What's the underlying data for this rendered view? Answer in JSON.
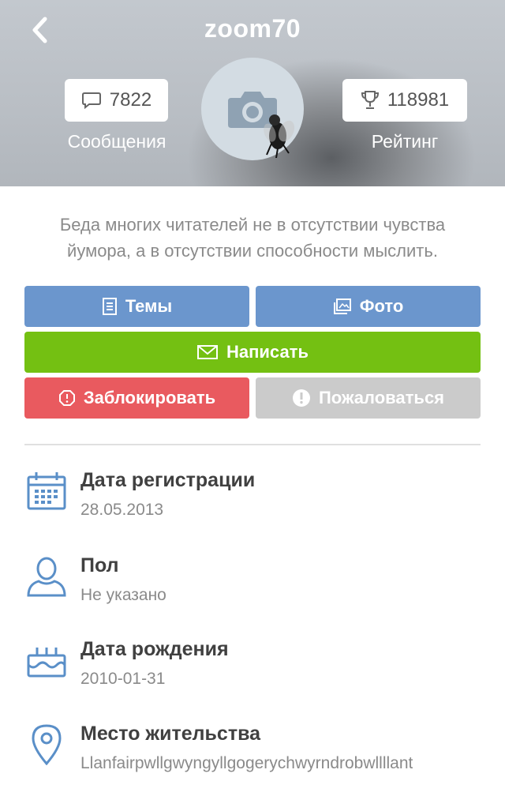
{
  "header": {
    "username": "zoom70",
    "messages_count": "7822",
    "messages_label": "Сообщения",
    "rating_count": "118981",
    "rating_label": "Рейтинг"
  },
  "profile": {
    "quote_line1": "Беда многих читателей не в отсутствии чувства",
    "quote_line2": "йумора, а в отсутствии способности мыслить."
  },
  "actions": {
    "themes": "Темы",
    "photo": "Фото",
    "write": "Написать",
    "block": "Заблокировать",
    "report": "Пожаловаться"
  },
  "info": [
    {
      "title": "Дата регистрации",
      "value": "28.05.2013",
      "icon": "calendar-icon"
    },
    {
      "title": "Пол",
      "value": "Не указано",
      "icon": "person-icon"
    },
    {
      "title": "Дата рождения",
      "value": "2010-01-31",
      "icon": "cake-icon"
    },
    {
      "title": "Место жительства",
      "value": "Llanfairpwllgwyngyllgogerychwyrndrobwllllant",
      "icon": "location-pin-icon"
    }
  ],
  "colors": {
    "blue": "#6b96cd",
    "green": "#74c012",
    "red": "#e95a5f",
    "gray": "#cbcbcb",
    "icon_blue": "#5a8fc8"
  }
}
